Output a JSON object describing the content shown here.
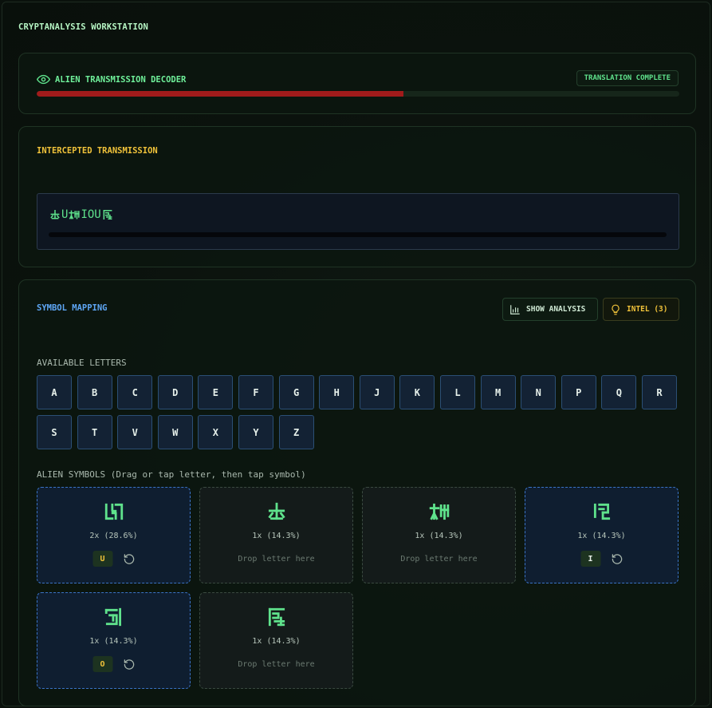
{
  "app": {
    "title": "CRYPTANALYSIS WORKSTATION"
  },
  "decoder": {
    "title": "ALIEN TRANSMISSION DECODER",
    "status": "TRANSLATION COMPLETE",
    "progress": 0.571,
    "accent": "#5fe28c",
    "progress_color": "#a11b1b"
  },
  "transmission": {
    "title": "INTERCEPTED TRANSMISSION",
    "segments": [
      {
        "kind": "glyph",
        "icon": "alien-glyph-2"
      },
      {
        "kind": "text",
        "value": "U"
      },
      {
        "kind": "glyph",
        "icon": "alien-glyph-3"
      },
      {
        "kind": "text",
        "value": "IOU"
      },
      {
        "kind": "glyph",
        "icon": "alien-glyph-6"
      }
    ]
  },
  "mapping": {
    "title": "SYMBOL MAPPING",
    "analysis_label": "SHOW ANALYSIS",
    "analysis_icon": "bar-chart-icon",
    "intel_label": "INTEL (3)",
    "intel_icon": "lightbulb-icon",
    "letters_label": "AVAILABLE LETTERS",
    "letters": [
      "A",
      "B",
      "C",
      "D",
      "E",
      "F",
      "G",
      "H",
      "J",
      "K",
      "L",
      "M",
      "N",
      "P",
      "Q",
      "R",
      "S",
      "T",
      "V",
      "W",
      "X",
      "Y",
      "Z"
    ],
    "symbols_label": "ALIEN SYMBOLS (Drag or tap letter, then tap symbol)",
    "drop_hint": "Drop letter here",
    "symbols": [
      {
        "icon": "alien-glyph-1",
        "count": "2x (28.6%)",
        "letter": "U",
        "letter_color": "#f0c23a"
      },
      {
        "icon": "alien-glyph-2",
        "count": "1x (14.3%)",
        "letter": ""
      },
      {
        "icon": "alien-glyph-3",
        "count": "1x (14.3%)",
        "letter": ""
      },
      {
        "icon": "alien-glyph-4",
        "count": "1x (14.3%)",
        "letter": "I",
        "letter_color": "#e8efe9"
      },
      {
        "icon": "alien-glyph-5",
        "count": "1x (14.3%)",
        "letter": "O",
        "letter_color": "#f0c23a"
      },
      {
        "icon": "alien-glyph-6",
        "count": "1x (14.3%)",
        "letter": ""
      }
    ]
  }
}
